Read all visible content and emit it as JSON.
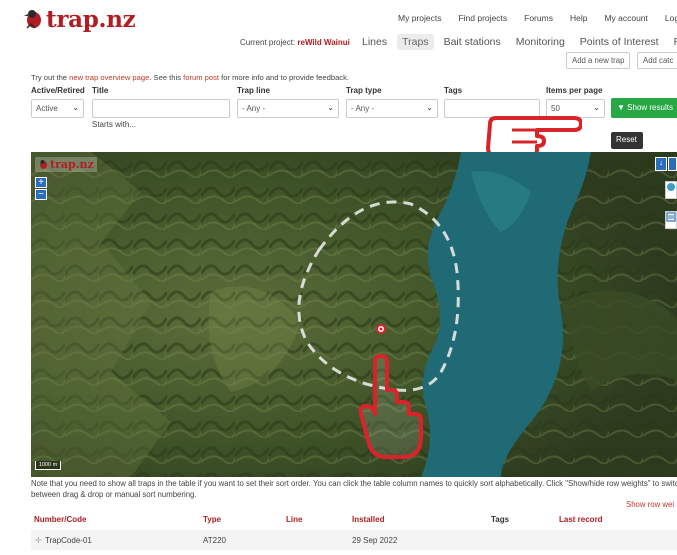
{
  "brand": {
    "name": "trap.nz"
  },
  "topnav": [
    "My projects",
    "Find projects",
    "Forums",
    "Help",
    "My account",
    "Log"
  ],
  "current_project": {
    "prefix": "Current project:",
    "name": "reWild Wainui"
  },
  "subnav": [
    {
      "label": "Lines",
      "active": false
    },
    {
      "label": "Traps",
      "active": true
    },
    {
      "label": "Bait stations",
      "active": false
    },
    {
      "label": "Monitoring",
      "active": false
    },
    {
      "label": "Points of Interest",
      "active": false
    },
    {
      "label": "Repo",
      "active": false
    }
  ],
  "actions": {
    "add_trap": "Add a new trap",
    "add_catch": "Add catc"
  },
  "notice": {
    "before": "Try out the ",
    "link1": "new trap overview page",
    "middle": ". See this ",
    "link2": "forum post",
    "after": " for more info and to provide feedback."
  },
  "filters": {
    "active_label": "Active/Retired",
    "active_value": "Active",
    "title_label": "Title",
    "title_value": "",
    "title_hint": "Starts with...",
    "line_label": "Trap line",
    "line_value": "- Any -",
    "type_label": "Trap type",
    "type_value": "- Any -",
    "tags_label": "Tags",
    "tags_value": "",
    "ipp_label": "Items per page",
    "ipp_value": "50",
    "show_results": "Show results",
    "reset": "Reset"
  },
  "map": {
    "brand": "trap.nz",
    "zoom_in": "+",
    "zoom_out": "−",
    "scale": "1000 m"
  },
  "note": "Note that you need to show all traps in the table if you want to set their sort order. You can click the table column names to quickly sort alphabetically. Click \"Show/hide row weights\" to switch between drag & drop or manual sort numbering.",
  "row_weights_link": "Show row wei",
  "table": {
    "headers": [
      "Number/Code",
      "Type",
      "Line",
      "Installed",
      "Tags",
      "Last record"
    ],
    "rows": [
      {
        "code": "TrapCode-01",
        "type": "AT220",
        "line": "",
        "installed": "29 Sep 2022",
        "tags": "",
        "last_record": ""
      }
    ]
  },
  "colors": {
    "brand": "#b01e23",
    "accent_green": "#28a745",
    "map_water": "#1e6a74"
  }
}
